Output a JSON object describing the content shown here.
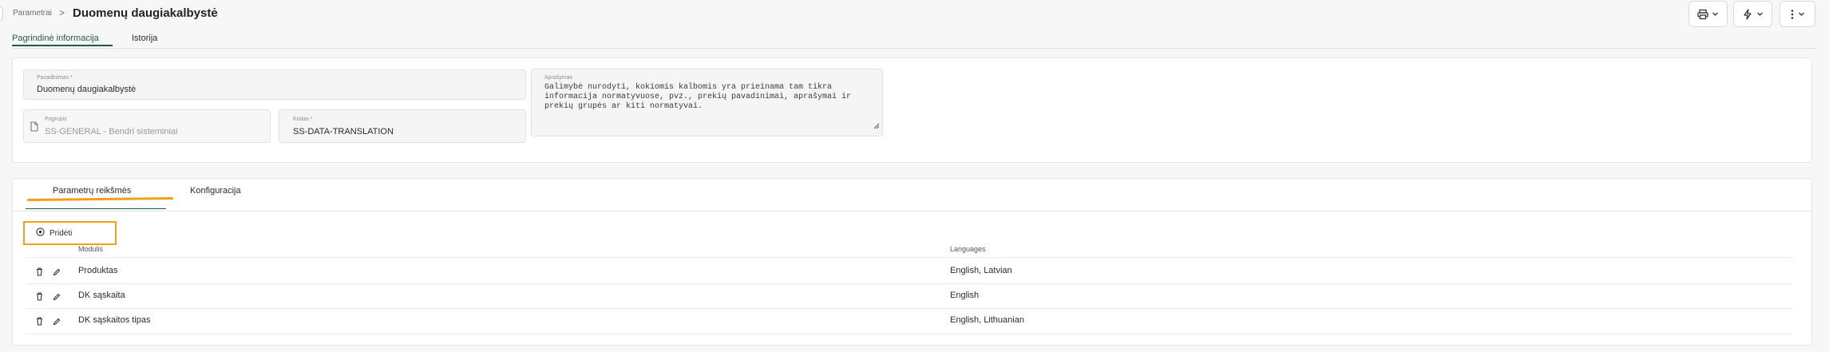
{
  "breadcrumb": {
    "parent": "Parametrai",
    "separator": ">"
  },
  "page": {
    "title": "Duomenų daugiakalbystė"
  },
  "toolbar": {
    "print_icon": "printer-icon",
    "action_icon": "lightning-icon",
    "more_icon": "more-vertical-icon"
  },
  "top_tabs": [
    {
      "label": "Pagrindinė informacija",
      "active": true
    },
    {
      "label": "Istorija",
      "active": false
    }
  ],
  "form": {
    "name": {
      "label": "Pavadinimas *",
      "value": "Duomenų daugiakalbystė"
    },
    "group": {
      "label": "Pogrupis",
      "value": "SS-GENERAL - Bendri sisteminiai",
      "icon": "document-icon"
    },
    "code": {
      "label": "Kodas *",
      "value": "SS-DATA-TRANSLATION"
    },
    "description": {
      "label": "Aprašymas",
      "lines": [
        "Galimybė nurodyti, kokiomis kalbomis yra prieinama tam tikra",
        "informacija normatyvuose, pvz., prekių pavadinimai, aprašymai ir",
        "prekių grupės ar kiti normatyvai."
      ]
    }
  },
  "bottom_tabs": [
    {
      "label": "Parametrų reikšmės",
      "active": true
    },
    {
      "label": "Konfiguracija",
      "active": false
    }
  ],
  "add_button": {
    "label": "Pridėti",
    "icon": "plus-circle-icon"
  },
  "table": {
    "columns": [
      "Modulis",
      "Languages"
    ],
    "rows": [
      {
        "module": "Produktas",
        "languages": "English, Latvian"
      },
      {
        "module": "DK sąskaita",
        "languages": "English"
      },
      {
        "module": "DK sąskaitos tipas",
        "languages": "English, Lithuanian"
      }
    ]
  },
  "colors": {
    "accent": "#1e5b4a",
    "highlight": "#f2a01b"
  }
}
